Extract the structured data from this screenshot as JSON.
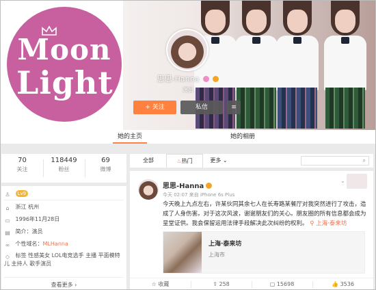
{
  "cover": {
    "logo_line1": "Moon",
    "logo_line2": "Light"
  },
  "profile": {
    "nickname": "思思-Hanna",
    "verified": "演员",
    "follow_label": "+ 关注",
    "message_label": "私信",
    "more_label": "≡"
  },
  "tabs": {
    "home": "她的主页",
    "album": "她的相册"
  },
  "stats": [
    {
      "num": "70",
      "label": "关注"
    },
    {
      "num": "118449",
      "label": "粉丝"
    },
    {
      "num": "69",
      "label": "微博"
    }
  ],
  "info": {
    "level": "Lv9",
    "location": "浙江 杭州",
    "birthday": "1996年11月28日",
    "intro": "简介：演员",
    "domain_prefix": "个性域名：",
    "domain": "MLHanna",
    "tags": "标签 性感美女 LOL电竞选手 主播 平面模特儿 主持人 歌手演员",
    "more": "查看更多 ›"
  },
  "filters": {
    "all": "全部",
    "hot": "热门",
    "more": "更多 ⌄"
  },
  "post": {
    "name": "思思-Hanna",
    "meta": "今天 02:07 来自 iPhone 6s Plus",
    "text": "今天晚上九点左右，许某伙同其余七人在长寿路某餐厅对我突然进行了攻击，造成了人身伤害。对于这次风波，谢谢朋友们的关心。朋友圈的所有信息都会成为呈堂证供。我会保留运用法律手段解决此次纠纷的权利。",
    "location": "上海·泰来坊",
    "card_title": "上海·泰来坊",
    "card_sub": "上海市",
    "actions": {
      "collect": "收藏",
      "repost": "258",
      "comment": "15698",
      "like": "3536"
    }
  }
}
